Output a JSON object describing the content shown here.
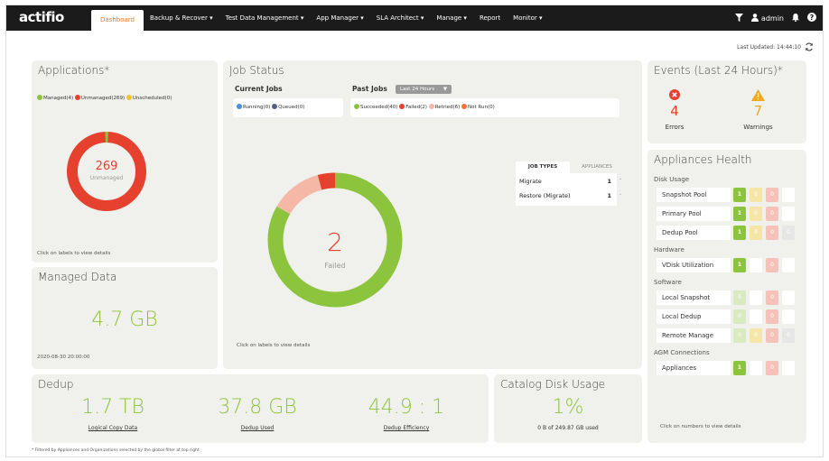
{
  "nav": {
    "logo": "actifio",
    "menu": [
      {
        "label": "Dashboard",
        "active": true
      },
      {
        "label": "Backup & Recover ▾"
      },
      {
        "label": "Test Data Management ▾"
      },
      {
        "label": "App Manager ▾"
      },
      {
        "label": "SLA Architect ▾"
      },
      {
        "label": "Manage ▾"
      },
      {
        "label": "Report"
      },
      {
        "label": "Monitor ▾"
      }
    ],
    "filter_icon": "filter-icon",
    "user_icon": "user-icon",
    "user": "admin",
    "bell_icon": "bell-icon",
    "help_icon": "help-icon"
  },
  "last_updated": "Last Updated: 14:44:10",
  "applications": {
    "title": "Applications*",
    "legend": [
      {
        "label": "Managed(4)",
        "color": "#8dc43d",
        "value": 4
      },
      {
        "label": "Unmanaged(269)",
        "color": "#e6402e",
        "value": 269
      },
      {
        "label": "Unscheduled(0)",
        "color": "#f5c036",
        "value": 0
      }
    ],
    "center_value": "269",
    "center_label": "Unmanaged",
    "hint": "Click on labels to view details"
  },
  "managed_data": {
    "title": "Managed Data",
    "value": "4.7 GB",
    "date": "2020-08-30 20:00:00"
  },
  "job_status": {
    "title": "Job Status",
    "current_jobs_label": "Current Jobs",
    "current_legend": [
      {
        "label": "Running(0)",
        "color": "#4a90d9"
      },
      {
        "label": "Queued(0)",
        "color": "#56607a"
      }
    ],
    "past_jobs_label": "Past Jobs",
    "past_select": "Last 24 Hours",
    "past_legend": [
      {
        "label": "Succeeded(40)",
        "color": "#8dc43d",
        "value": 40
      },
      {
        "label": "Failed(2)",
        "color": "#e6402e",
        "value": 2
      },
      {
        "label": "Retried(6)",
        "color": "#f5b8a6",
        "value": 6
      },
      {
        "label": "Not Run(0)",
        "color": "#f07335",
        "value": 0
      }
    ],
    "center_value": "2",
    "center_label": "Failed",
    "hint": "Click on labels to view details",
    "tabs": [
      "JOB TYPES",
      "APPLIANCES"
    ],
    "job_types": [
      {
        "name": "Migrate",
        "count": "1"
      },
      {
        "name": "Restore (Migrate)",
        "count": "1"
      }
    ]
  },
  "events": {
    "title": "Events (Last 24 Hours)*",
    "errors_value": "4",
    "errors_label": "Errors",
    "warnings_value": "7",
    "warnings_label": "Warnings"
  },
  "health": {
    "title": "Appliances Health",
    "groups": [
      {
        "label": "Disk Usage",
        "rows": [
          {
            "name": "Snapshot Pool",
            "cells": [
              "1",
              "0",
              "0",
              ""
            ]
          },
          {
            "name": "Primary Pool",
            "cells": [
              "1",
              "0",
              "0",
              ""
            ]
          },
          {
            "name": "Dedup Pool",
            "cells": [
              "1",
              "0",
              "0",
              "0"
            ]
          }
        ]
      },
      {
        "label": "Hardware",
        "rows": [
          {
            "name": "VDisk Utilization",
            "cells": [
              "1",
              "",
              "0",
              ""
            ]
          }
        ]
      },
      {
        "label": "Software",
        "rows": [
          {
            "name": "Local Snapshot",
            "cells": [
              "0",
              "",
              "0",
              ""
            ]
          },
          {
            "name": "Local Dedup",
            "cells": [
              "0",
              "",
              "0",
              ""
            ]
          },
          {
            "name": "Remote Manage",
            "cells": [
              "0",
              "0",
              "0",
              "0"
            ]
          }
        ]
      },
      {
        "label": "AGM Connections",
        "rows": [
          {
            "name": "Appliances",
            "cells": [
              "1",
              "",
              "0",
              ""
            ]
          }
        ]
      }
    ],
    "hint": "Click on numbers to view details"
  },
  "dedup": {
    "title": "Dedup",
    "metrics": [
      {
        "value": "1.7 TB",
        "label": "Logical Copy Data"
      },
      {
        "value": "37.8 GB",
        "label": "Dedup Used"
      },
      {
        "value": "44.9 : 1",
        "label": "Dedup Efficiency"
      }
    ]
  },
  "catalog": {
    "title": "Catalog Disk Usage",
    "value": "1%",
    "detail": "0 B of 249.87 GB used"
  },
  "footnote": "* Filtered by Appliances and Organizations selected by the global filter at top right",
  "colors": {
    "green": "#8dc43d",
    "red": "#e6402e",
    "pink": "#f5b8a6",
    "orange": "#f07335",
    "warn": "#f0a81e"
  }
}
